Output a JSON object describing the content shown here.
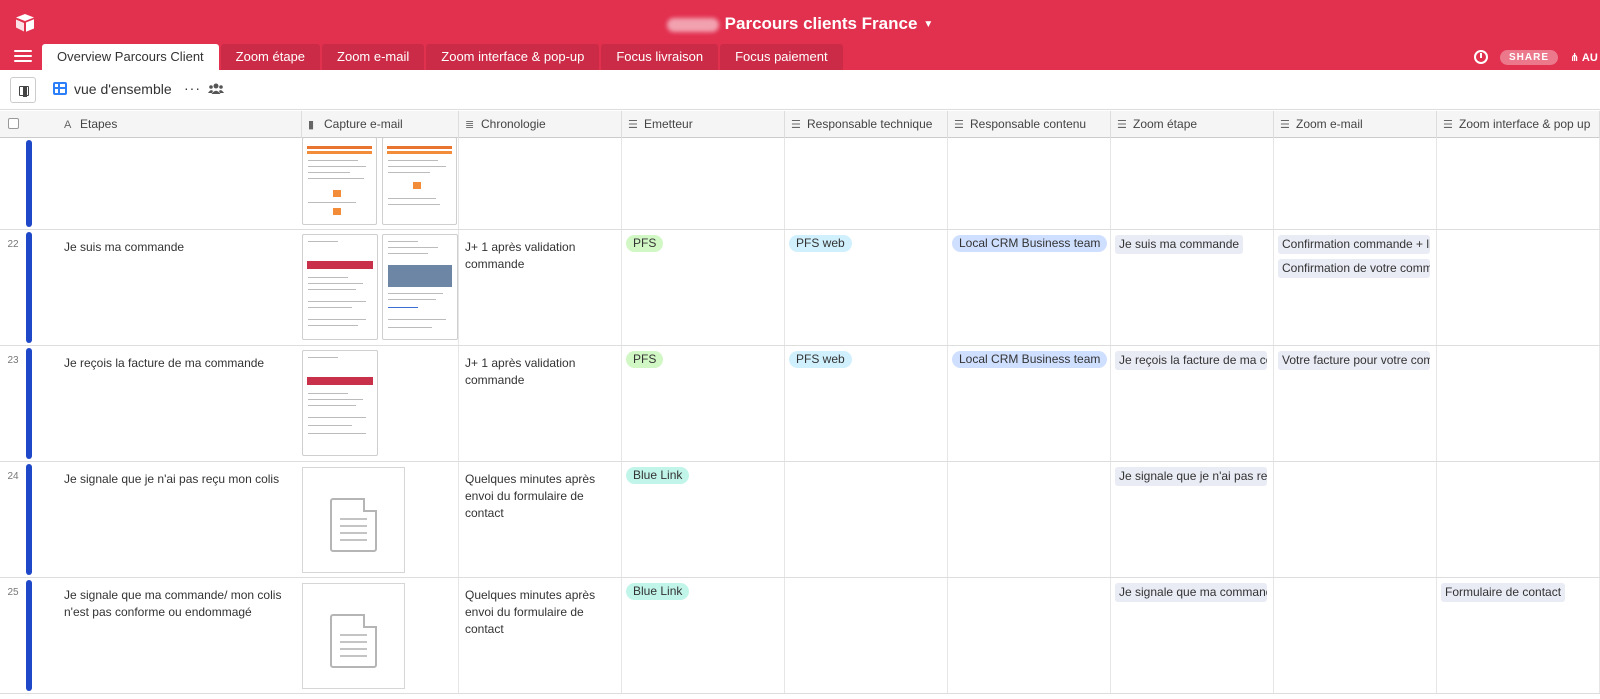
{
  "app": {
    "base_title": "Parcours clients France",
    "logo_icon": "airtable-logo-icon",
    "accent_color": "#e2304f"
  },
  "tabs": [
    {
      "label": "Overview Parcours Client",
      "active": true
    },
    {
      "label": "Zoom étape",
      "active": false
    },
    {
      "label": "Zoom e-mail",
      "active": false
    },
    {
      "label": "Zoom interface & pop-up",
      "active": false
    },
    {
      "label": "Focus livraison",
      "active": false
    },
    {
      "label": "Focus paiement",
      "active": false
    }
  ],
  "top_right": {
    "share_label": "SHARE",
    "automations_label": "AU"
  },
  "viewbar": {
    "view_name": "vue d'ensemble",
    "more_label": "···"
  },
  "columns": [
    {
      "label": "Etapes",
      "icon": "text-icon"
    },
    {
      "label": "Capture e-mail",
      "icon": "attachment-icon"
    },
    {
      "label": "Chronologie",
      "icon": "long-text-icon"
    },
    {
      "label": "Emetteur",
      "icon": "multi-select-icon"
    },
    {
      "label": "Responsable technique",
      "icon": "multi-select-icon"
    },
    {
      "label": "Responsable contenu",
      "icon": "multi-select-icon"
    },
    {
      "label": "Zoom étape",
      "icon": "link-icon"
    },
    {
      "label": "Zoom e-mail",
      "icon": "link-icon"
    },
    {
      "label": "Zoom interface & pop up",
      "icon": "link-icon"
    }
  ],
  "rows": [
    {
      "num": "",
      "etape": "",
      "chronologie": "",
      "emetteur": "",
      "resp_tech": "",
      "resp_contenu": "",
      "zoom_etape": "",
      "zoom_email": [],
      "zoom_interface": ""
    },
    {
      "num": "22",
      "etape": "Je suis ma commande",
      "chronologie": "J+ 1 après validation commande",
      "emetteur": "PFS",
      "resp_tech": "PFS web",
      "resp_contenu": "Local CRM Business team",
      "zoom_etape": "Je suis ma commande",
      "zoom_email": [
        "Confirmation commande + li",
        "Confirmation de votre comma"
      ],
      "zoom_interface": ""
    },
    {
      "num": "23",
      "etape": "Je reçois la facture de ma commande",
      "chronologie": "J+ 1 après validation commande",
      "emetteur": "PFS",
      "resp_tech": "PFS web",
      "resp_contenu": "Local CRM Business team",
      "zoom_etape": "Je reçois la facture de ma com",
      "zoom_email": [
        "Votre facture pour votre com"
      ],
      "zoom_interface": ""
    },
    {
      "num": "24",
      "etape": "Je signale que je n'ai pas reçu mon colis",
      "chronologie": "Quelques minutes après envoi du formulaire de contact",
      "emetteur": "Blue Link",
      "resp_tech": "",
      "resp_contenu": "",
      "zoom_etape": "Je signale que je n'ai pas reçu",
      "zoom_email": [],
      "zoom_interface": ""
    },
    {
      "num": "25",
      "etape": "Je signale que ma commande/ mon colis n'est pas conforme ou endommagé",
      "chronologie": "Quelques minutes après envoi du formulaire de contact",
      "emetteur": "Blue Link",
      "resp_tech": "",
      "resp_contenu": "",
      "zoom_etape": "Je signale que ma commande",
      "zoom_email": [],
      "zoom_interface": "Formulaire de contact"
    }
  ],
  "pill_colors": {
    "PFS": "#d1f7c4",
    "PFS web": "#d0f0fd",
    "Local CRM Business team": "#cfdfff",
    "Blue Link": "#c2f5e9"
  },
  "row_color": "#1f48c8"
}
